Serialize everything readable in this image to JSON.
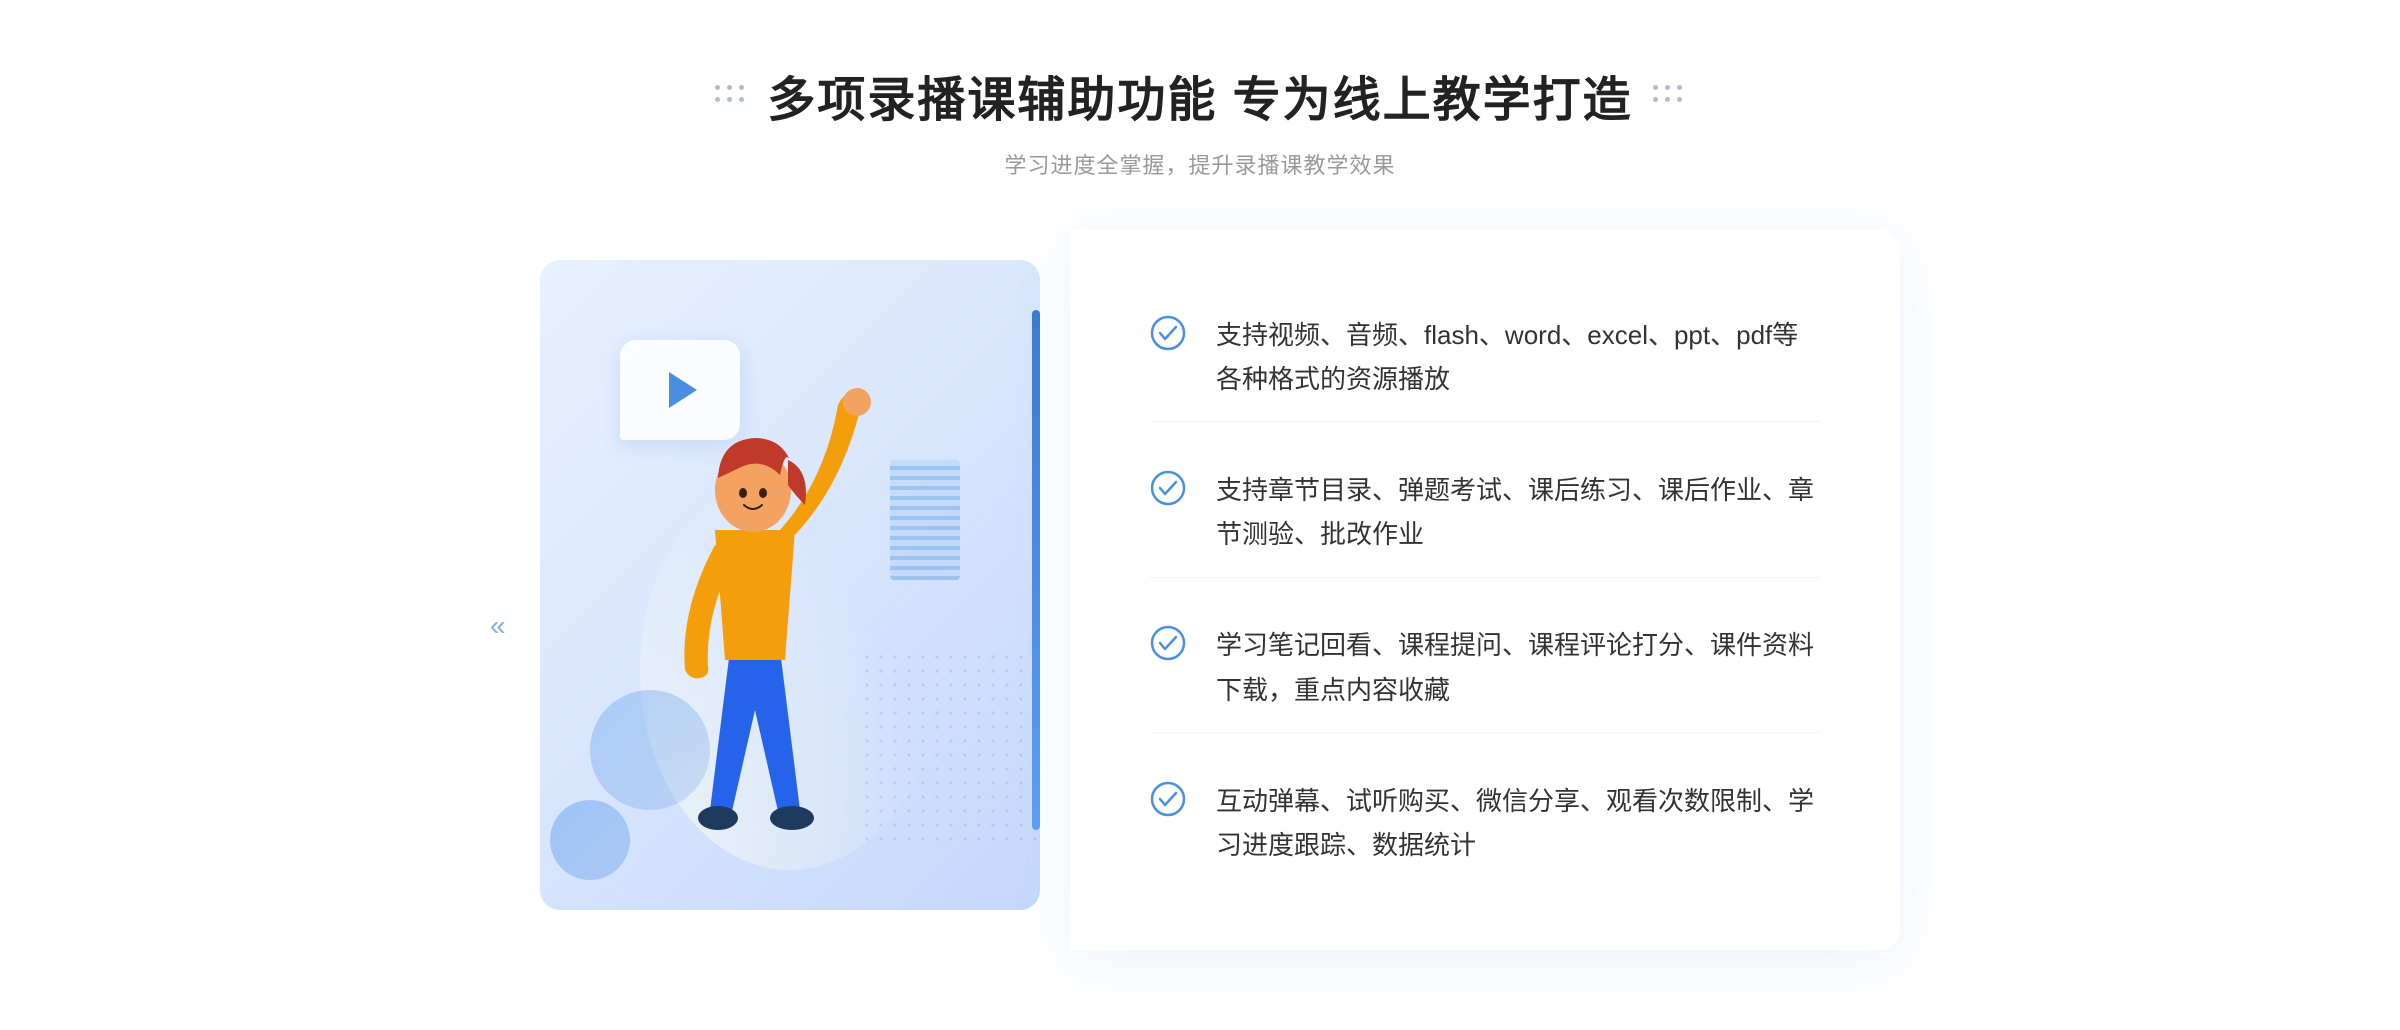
{
  "header": {
    "main_title": "多项录播课辅助功能 专为线上教学打造",
    "sub_title": "学习进度全掌握，提升录播课教学效果"
  },
  "features": [
    {
      "id": 1,
      "text": "支持视频、音频、flash、word、excel、ppt、pdf等各种格式的资源播放"
    },
    {
      "id": 2,
      "text": "支持章节目录、弹题考试、课后练习、课后作业、章节测验、批改作业"
    },
    {
      "id": 3,
      "text": "学习笔记回看、课程提问、课程评论打分、课件资料下载，重点内容收藏"
    },
    {
      "id": 4,
      "text": "互动弹幕、试听购买、微信分享、观看次数限制、学习进度跟踪、数据统计"
    }
  ],
  "icons": {
    "check": "check-circle-icon",
    "play": "play-icon",
    "left_arrow": "left-arrow-icon",
    "dots_left": "dots-decoration-left",
    "dots_right": "dots-decoration-right"
  },
  "colors": {
    "primary": "#4a90e2",
    "accent": "#3a7bd5",
    "text_dark": "#222222",
    "text_mid": "#333333",
    "text_light": "#999999",
    "bg_white": "#ffffff",
    "check_color": "#4a90e2"
  }
}
